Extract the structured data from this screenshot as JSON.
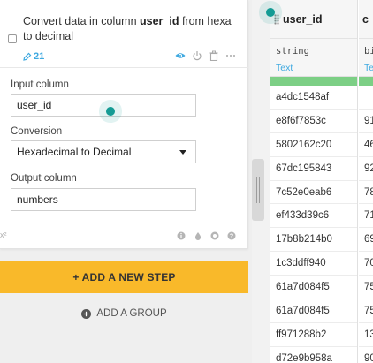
{
  "step": {
    "title_prefix": "Convert data in column ",
    "title_column": "user_id",
    "title_suffix": " from hexa to decimal",
    "count": "21",
    "input_column_label": "Input column",
    "input_column_value": "user_id",
    "conversion_label": "Conversion",
    "conversion_value": "Hexadecimal to Decimal",
    "output_column_label": "Output column",
    "output_column_value": "numbers",
    "footer_tag": "x²"
  },
  "buttons": {
    "add_step": "+ ADD A NEW STEP",
    "add_group": "ADD A GROUP"
  },
  "table": {
    "columns": [
      {
        "name": "user_id",
        "type": "string",
        "meaning": "Text"
      },
      {
        "name": "c",
        "type": "bi",
        "meaning": "Te"
      }
    ],
    "user_id_values": [
      "a4dc1548af",
      "e8f6f7853c",
      "5802162c20",
      "67dc195843",
      "7c52e0eab6",
      "ef433d39c6",
      "17b8b214b0",
      "1c3ddff940",
      "61a7d084f5",
      "61a7d084f5",
      "ff971288b2",
      "d72e9b958a"
    ],
    "next_values": [
      "",
      "91",
      "46",
      "92",
      "78",
      "71",
      "69",
      "70",
      "75",
      "75",
      "13",
      "90"
    ]
  },
  "colors": {
    "accent_yellow": "#f9b92a",
    "link_blue": "#3fa9e0",
    "valid_green": "#7ccf85",
    "cursor_teal": "#149b94"
  }
}
